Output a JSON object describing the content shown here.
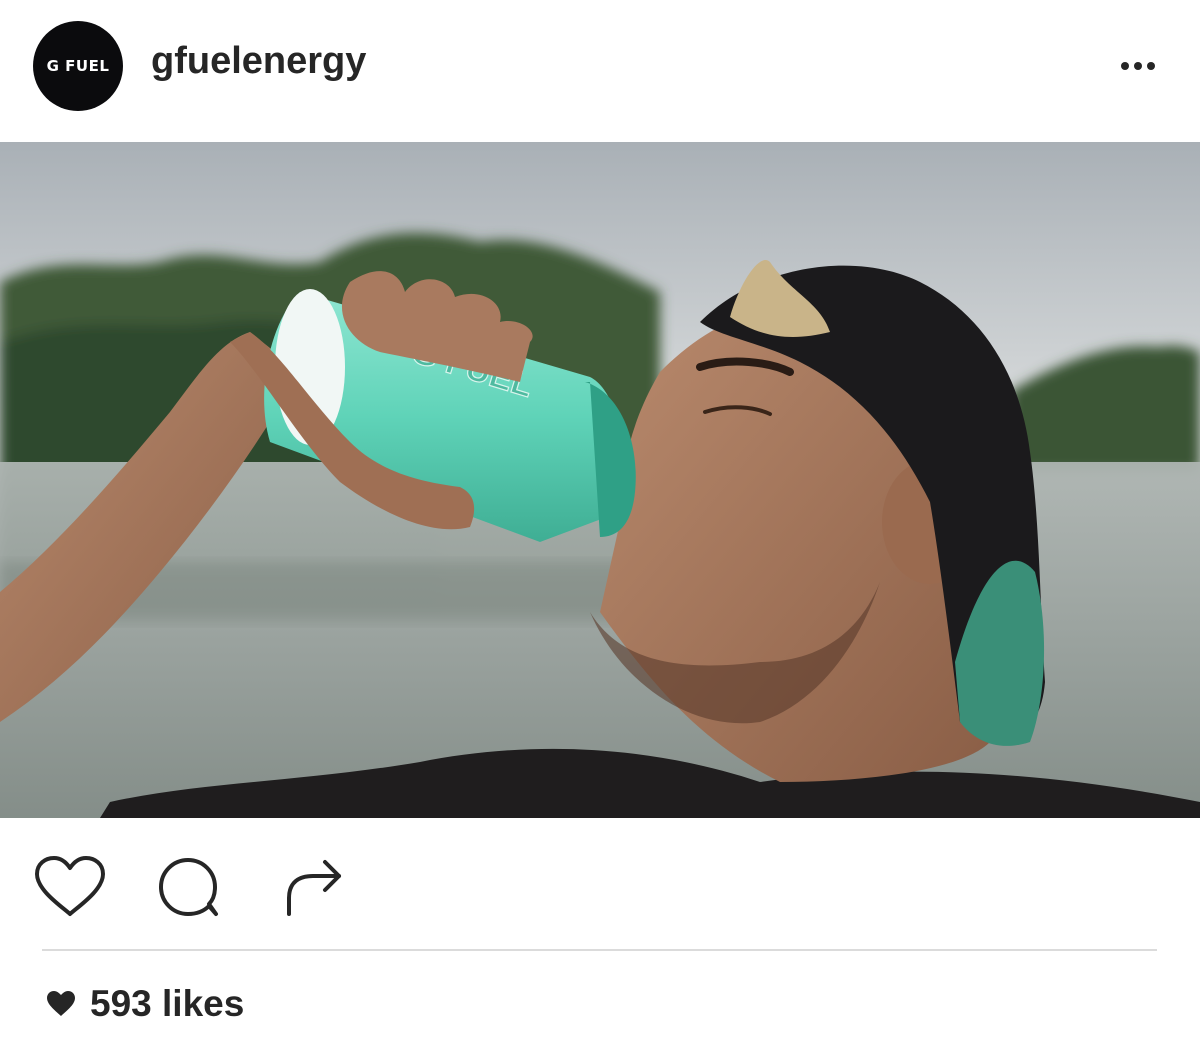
{
  "post": {
    "avatar_text": "G FUEL",
    "username": "gfuelenergy",
    "menu_icon": "more-horizontal-icon",
    "photo_alt": "Man drinking from a G FUEL shaker cup outdoors by a river",
    "shaker_brand": "G FUEL",
    "actions": {
      "like_icon": "heart-outline-icon",
      "comment_icon": "comment-bubble-icon",
      "share_icon": "share-arrow-icon"
    },
    "likes_icon": "heart-filled-icon",
    "likes_text": "593 likes"
  },
  "colors": {
    "text": "#262626",
    "divider": "#dbdbdb",
    "shaker_teal": "#5fd3b8",
    "avatar_bg": "#0b0b0d"
  }
}
